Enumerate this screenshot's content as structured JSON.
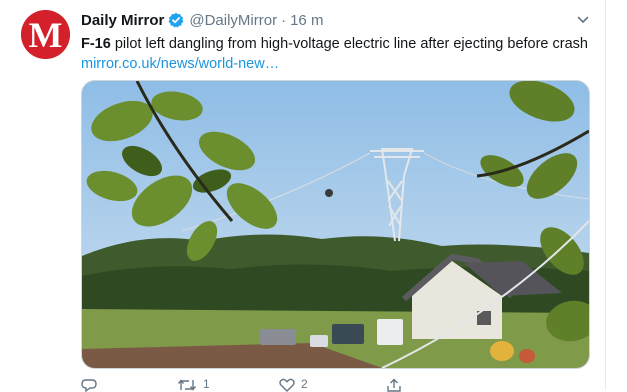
{
  "tweet": {
    "author_name": "Daily Mirror",
    "handle": "@DailyMirror",
    "separator": "·",
    "time": "16 m",
    "text_bold": "F-16",
    "text_line": " pilot left dangling from high-voltage electric line after ejecting before crash ",
    "link": "mirror.co.uk/news/world-new…",
    "avatar_letter": "M",
    "brand_color": "#d3202a",
    "link_color": "#1b95e0",
    "verified_color": "#1da1f2"
  },
  "actions": {
    "reply_count": "",
    "retweet_count": "1",
    "like_count": "2"
  },
  "icons": [
    "verified-badge-icon",
    "chevron-down-icon",
    "reply-icon",
    "retweet-icon",
    "like-icon",
    "share-icon"
  ]
}
